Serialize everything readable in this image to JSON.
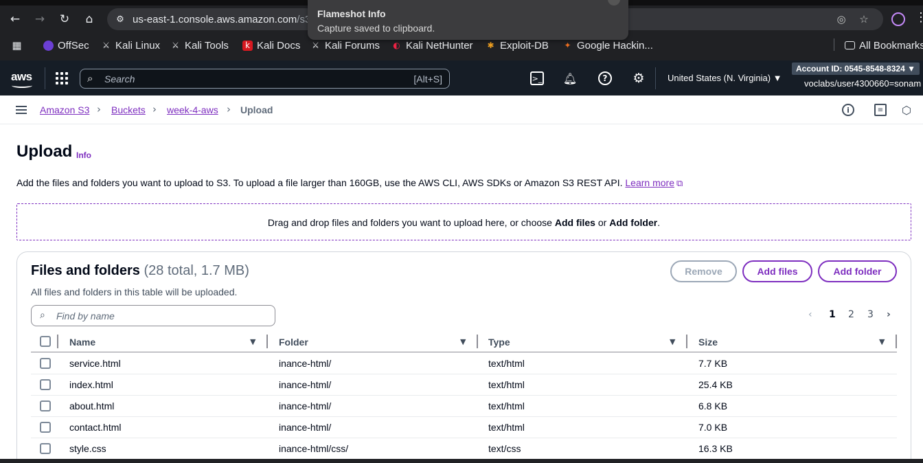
{
  "browser": {
    "url_host": "us-east-1.console.aws.amazon.com",
    "url_path": "/s3/up",
    "bookmarks": [
      "OffSec",
      "Kali Linux",
      "Kali Tools",
      "Kali Docs",
      "Kali Forums",
      "Kali NetHunter",
      "Exploit-DB",
      "Google Hackin..."
    ],
    "all_bookmarks": "All Bookmarks"
  },
  "notification": {
    "title": "Flameshot Info",
    "body": "Capture saved to clipboard."
  },
  "aws_nav": {
    "logo": "aws",
    "search_placeholder": "Search",
    "search_shortcut": "[Alt+S]",
    "region": "United States (N. Virginia) ▼",
    "account_id": "Account ID: 0545-8548-8324 ▼",
    "user": "voclabs/user4300660=sonam"
  },
  "breadcrumb": {
    "items": [
      "Amazon S3",
      "Buckets",
      "week-4-aws"
    ],
    "current": "Upload"
  },
  "page": {
    "title": "Upload",
    "info": "Info",
    "description": "Add the files and folders you want to upload to S3. To upload a file larger than 160GB, use the AWS CLI, AWS SDKs or Amazon S3 REST API.",
    "learn_more": "Learn more",
    "dropzone_pre": "Drag and drop files and folders you want to upload here, or choose ",
    "dropzone_add_files": "Add files",
    "dropzone_or": " or ",
    "dropzone_add_folder": "Add folder",
    "dropzone_end": "."
  },
  "files_panel": {
    "title": "Files and folders",
    "count": "(28 total, 1.7 MB)",
    "subtitle": "All files and folders in this table will be uploaded.",
    "remove_label": "Remove",
    "add_files_label": "Add files",
    "add_folder_label": "Add folder",
    "search_placeholder": "Find by name",
    "pages": [
      "1",
      "2",
      "3"
    ],
    "current_page": "1",
    "columns": [
      "Name",
      "Folder",
      "Type",
      "Size"
    ],
    "rows": [
      {
        "name": "service.html",
        "folder": "inance-html/",
        "type": "text/html",
        "size": "7.7 KB"
      },
      {
        "name": "index.html",
        "folder": "inance-html/",
        "type": "text/html",
        "size": "25.4 KB"
      },
      {
        "name": "about.html",
        "folder": "inance-html/",
        "type": "text/html",
        "size": "6.8 KB"
      },
      {
        "name": "contact.html",
        "folder": "inance-html/",
        "type": "text/html",
        "size": "7.0 KB"
      },
      {
        "name": "style.css",
        "folder": "inance-html/css/",
        "type": "text/css",
        "size": "16.3 KB"
      }
    ]
  },
  "colors": {
    "accent": "#7d2dbf",
    "aws_nav_bg": "#161d26",
    "browser_bg": "#202124"
  }
}
